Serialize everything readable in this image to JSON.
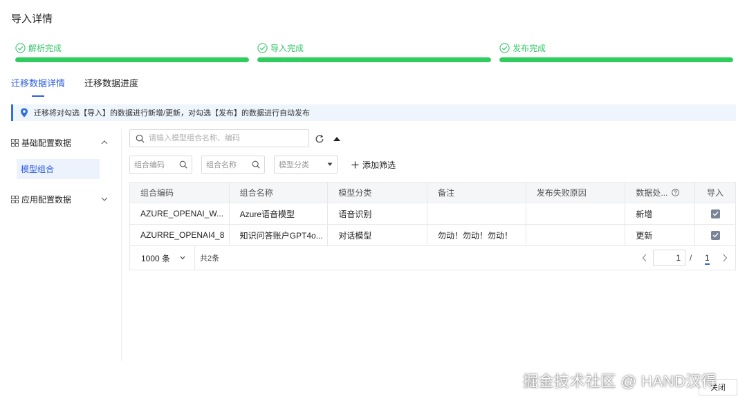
{
  "header": {
    "title": "导入详情"
  },
  "steps": [
    {
      "label": "解析完成",
      "progress": 1.0
    },
    {
      "label": "导入完成",
      "progress": 1.0
    },
    {
      "label": "发布完成",
      "progress": 1.0
    }
  ],
  "tabs": [
    {
      "label": "迁移数据详情",
      "active": true
    },
    {
      "label": "迁移数据进度",
      "active": false
    }
  ],
  "notice": {
    "text": "迁移将对勾选【导入】的数据进行新增/更新，对勾选【发布】的数据进行自动发布"
  },
  "sidebar": {
    "groups": [
      {
        "label": "基础配置数据",
        "expanded": true,
        "items": [
          {
            "label": "模型组合",
            "active": true
          }
        ]
      },
      {
        "label": "应用配置数据",
        "expanded": false,
        "items": []
      }
    ]
  },
  "search": {
    "placeholder": "请输入模型组合名称、编码",
    "value": ""
  },
  "filters": {
    "code_placeholder": "组合编码",
    "name_placeholder": "组合名称",
    "category_placeholder": "模型分类",
    "add_label": "添加筛选"
  },
  "table": {
    "columns": [
      "组合编码",
      "组合名称",
      "模型分类",
      "备注",
      "发布失败原因",
      "数据处...",
      "导入"
    ],
    "rows": [
      {
        "code": "AZURE_OPENAI_W...",
        "name": "Azure语音模型",
        "category": "语音识别",
        "note": "",
        "fail_reason": "",
        "action": "新增",
        "imported": true
      },
      {
        "code": "AZURRE_OPENAI4_8",
        "name": "知识问答账户GPT4o...",
        "category": "对话模型",
        "note": "勿动！勿动！勿动！",
        "fail_reason": "",
        "action": "更新",
        "imported": true
      }
    ]
  },
  "pager": {
    "page_size": "1000 条",
    "total": "共2条",
    "current": "1",
    "separator": "/",
    "pages": "1"
  },
  "watermark": "掘金技术社区 @ HAND汉得",
  "footer": {
    "close_label": "关闭"
  },
  "colors": {
    "primary": "#2f5ee0",
    "success": "#2fcd5e",
    "checkbox": "#7a8494"
  }
}
